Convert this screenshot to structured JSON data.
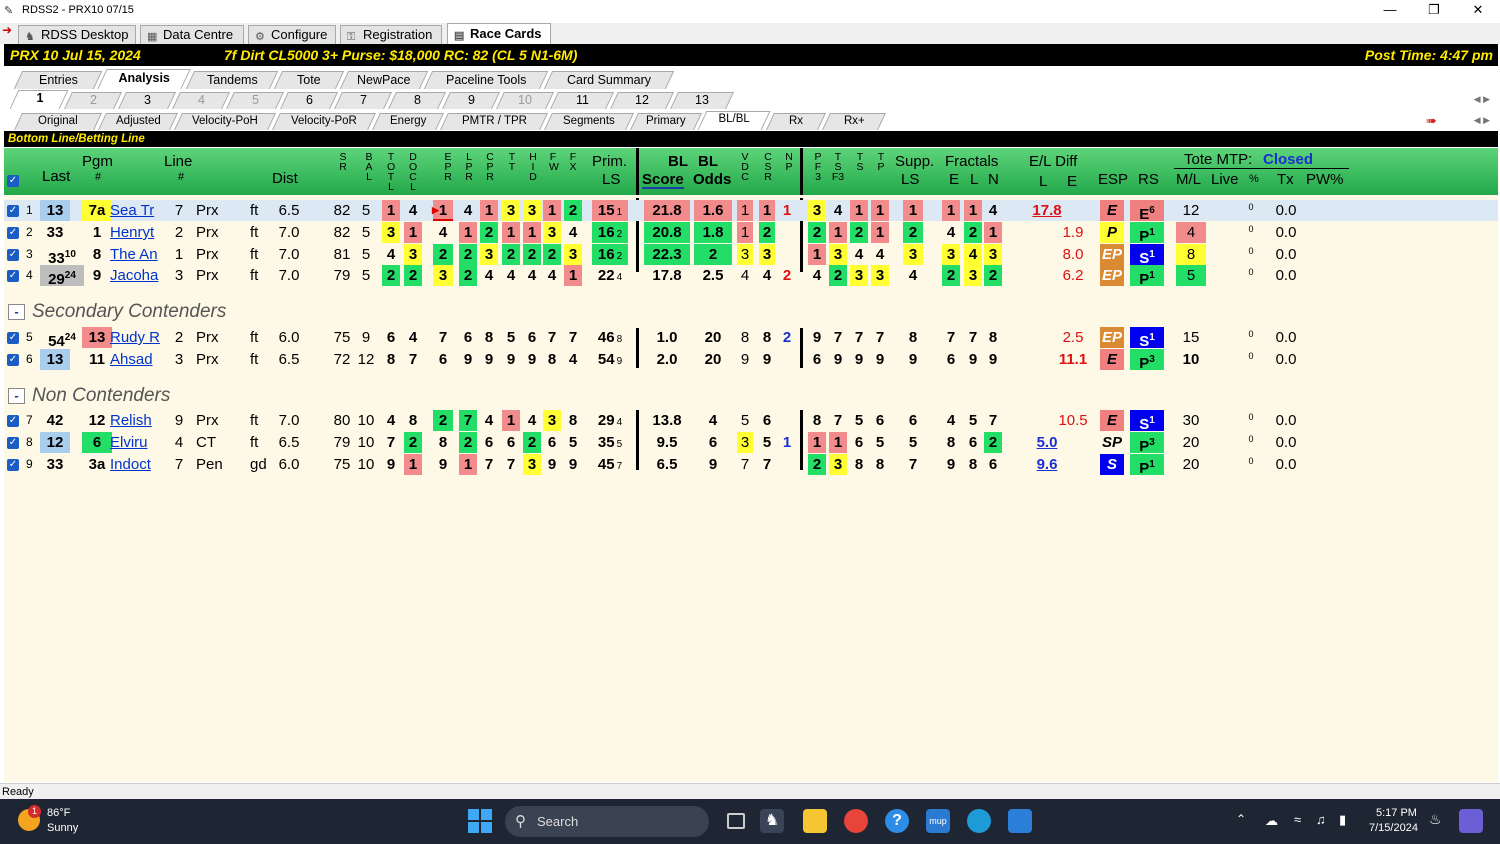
{
  "window": {
    "title": "RDSS2 - PRX10  07/15"
  },
  "main_tabs": [
    "RDSS Desktop",
    "Data Centre",
    "Configure",
    "Registration",
    "Race Cards"
  ],
  "race_header": {
    "left": "PRX  10   Jul 15, 2024",
    "center": "7f  Dirt   CL5000  3+   Purse: $18,000   RC: 82  (CL 5 N1-6M)",
    "right": "Post Time: 4:47 pm"
  },
  "sub_tabs": [
    "Entries",
    "Analysis",
    "Tandems",
    "Tote",
    "NewPace",
    "Paceline Tools",
    "Card Summary"
  ],
  "race_tabs": [
    "1",
    "2",
    "3",
    "4",
    "5",
    "6",
    "7",
    "8",
    "9",
    "10",
    "11",
    "12",
    "13"
  ],
  "view_tabs": [
    "Original",
    "Adjusted",
    "Velocity-PoH",
    "Velocity-PoR",
    "Energy",
    "PMTR / TPR",
    "Segments",
    "Primary",
    "BL/BL",
    "Rx",
    "Rx+"
  ],
  "section_title": "Bottom Line/Betting Line",
  "headers": {
    "last": "Last",
    "pgm": "Pgm",
    "pgm_hash": "#",
    "line": "Line",
    "line_hash": "#",
    "dist": "Dist",
    "sr": "S R",
    "bal": "B A L",
    "totl": "T O T L",
    "docl": "D O C L",
    "epr": "E P R",
    "lpr": "L P R",
    "cpr": "C P R",
    "tt": "T T",
    "hid": "H I D",
    "fw": "F W",
    "fx": "F X",
    "prim": "Prim.",
    "prim_ls": "LS",
    "bl": "BL",
    "score": "Score",
    "bl2": "BL",
    "odds": "Odds",
    "vdc": "V D C",
    "csr": "C S R",
    "np": "N P",
    "pf3": "P F 3",
    "tsf3": "T S F3",
    "ts": "T S",
    "tp": "T P",
    "supp": "Supp.",
    "supp_ls": "LS",
    "fractals": "Fractals",
    "frac_e": "E",
    "frac_l": "L",
    "frac_n": "N",
    "el_diff": "E/L Diff",
    "el_l": "L",
    "el_e": "E",
    "esp": "ESP",
    "rs": "RS",
    "tote": "Tote MTP:",
    "tote_status": "Closed",
    "ml": "M/L",
    "live": "Live",
    "pct": "%",
    "tx": "Tx",
    "pw": "PW%"
  },
  "groups": {
    "secondary": "Secondary Contenders",
    "non": "Non Contenders",
    "toggle": "-"
  },
  "rows": [
    {
      "n": "1",
      "last": "13",
      "pgm": "7a",
      "name": "Sea Tr",
      "line": "7",
      "trk": "Prx",
      "surf": "ft",
      "dist": "6.5",
      "sr": "82",
      "bal": "5",
      "totl": "1",
      "docl": "4",
      "epr": "1",
      "lpr": "4",
      "cpr": "1",
      "tt": "3",
      "hid": "3",
      "fw": "1",
      "fx": "2",
      "prim": "15",
      "prim_s": "1",
      "score": "21.8",
      "odds": "1.6",
      "vdc": "1",
      "csr": "1",
      "np": "1",
      "pf3": "3",
      "tsf3": "4",
      "ts": "1",
      "tp": "1",
      "supp": "1",
      "fe": "1",
      "fl": "1",
      "fn": "4",
      "ell": "17.8",
      "ele": "",
      "esp": "E",
      "rs": "E",
      "rs_s": "6",
      "ml": "12",
      "pct": "0",
      "tx": "0.0"
    },
    {
      "n": "2",
      "last": "33",
      "pgm": "1",
      "name": "Henryt",
      "line": "2",
      "trk": "Prx",
      "surf": "ft",
      "dist": "7.0",
      "sr": "82",
      "bal": "5",
      "totl": "3",
      "docl": "1",
      "epr": "4",
      "lpr": "1",
      "cpr": "2",
      "tt": "1",
      "hid": "1",
      "fw": "3",
      "fx": "4",
      "prim": "16",
      "prim_s": "2",
      "score": "20.8",
      "odds": "1.8",
      "vdc": "1",
      "csr": "2",
      "np": "",
      "pf3": "2",
      "tsf3": "1",
      "ts": "2",
      "tp": "1",
      "supp": "2",
      "fe": "4",
      "fl": "2",
      "fn": "1",
      "ell": "",
      "ele": "1.9",
      "esp": "P",
      "rs": "P",
      "rs_s": "1",
      "ml": "4",
      "pct": "0",
      "tx": "0.0"
    },
    {
      "n": "3",
      "last": "33",
      "last_s": "10",
      "pgm": "8",
      "name": "The An",
      "line": "1",
      "trk": "Prx",
      "surf": "ft",
      "dist": "7.0",
      "sr": "81",
      "bal": "5",
      "totl": "4",
      "docl": "3",
      "epr": "2",
      "lpr": "2",
      "cpr": "3",
      "tt": "2",
      "hid": "2",
      "fw": "2",
      "fx": "3",
      "prim": "16",
      "prim_s": "2",
      "score": "22.3",
      "odds": "2",
      "vdc": "3",
      "csr": "3",
      "np": "",
      "pf3": "1",
      "tsf3": "3",
      "ts": "4",
      "tp": "4",
      "supp": "3",
      "fe": "3",
      "fl": "4",
      "fn": "3",
      "ell": "",
      "ele": "8.0",
      "esp": "EP",
      "rs": "S",
      "rs_s": "1",
      "ml": "8",
      "pct": "0",
      "tx": "0.0"
    },
    {
      "n": "4",
      "last": "29",
      "last_s": "24",
      "pgm": "9",
      "name": "Jacoha",
      "line": "3",
      "trk": "Prx",
      "surf": "ft",
      "dist": "7.0",
      "sr": "79",
      "bal": "5",
      "totl": "2",
      "docl": "2",
      "epr": "3",
      "lpr": "2",
      "cpr": "4",
      "tt": "4",
      "hid": "4",
      "fw": "4",
      "fx": "1",
      "prim": "22",
      "prim_s": "4",
      "score": "17.8",
      "odds": "2.5",
      "vdc": "4",
      "csr": "4",
      "np": "2",
      "pf3": "4",
      "tsf3": "2",
      "ts": "3",
      "tp": "3",
      "supp": "4",
      "fe": "2",
      "fl": "3",
      "fn": "2",
      "ell": "",
      "ele": "6.2",
      "esp": "EP",
      "rs": "P",
      "rs_s": "1",
      "ml": "5",
      "pct": "0",
      "tx": "0.0"
    },
    {
      "n": "5",
      "last": "54",
      "last_s": "24",
      "pgm": "13",
      "name": "Rudy R",
      "line": "2",
      "trk": "Prx",
      "surf": "ft",
      "dist": "6.0",
      "sr": "75",
      "bal": "9",
      "totl": "6",
      "docl": "4",
      "epr": "7",
      "lpr": "6",
      "cpr": "8",
      "tt": "5",
      "hid": "6",
      "fw": "7",
      "fx": "7",
      "prim": "46",
      "prim_s": "8",
      "score": "1.0",
      "odds": "20",
      "vdc": "8",
      "csr": "8",
      "np": "2",
      "pf3": "9",
      "tsf3": "7",
      "ts": "7",
      "tp": "7",
      "supp": "8",
      "fe": "7",
      "fl": "7",
      "fn": "8",
      "ell": "",
      "ele": "2.5",
      "esp": "EP",
      "rs": "S",
      "rs_s": "1",
      "ml": "15",
      "pct": "0",
      "tx": "0.0"
    },
    {
      "n": "6",
      "last": "13",
      "pgm": "11",
      "name": "Ahsad",
      "line": "3",
      "trk": "Prx",
      "surf": "ft",
      "dist": "6.5",
      "sr": "72",
      "bal": "12",
      "totl": "8",
      "docl": "7",
      "epr": "6",
      "lpr": "9",
      "cpr": "9",
      "tt": "9",
      "hid": "9",
      "fw": "8",
      "fx": "4",
      "prim": "54",
      "prim_s": "9",
      "score": "2.0",
      "odds": "20",
      "vdc": "9",
      "csr": "9",
      "np": "",
      "pf3": "6",
      "tsf3": "9",
      "ts": "9",
      "tp": "9",
      "supp": "9",
      "fe": "6",
      "fl": "9",
      "fn": "9",
      "ell": "",
      "ele": "11.1",
      "esp": "E",
      "rs": "P",
      "rs_s": "3",
      "ml": "10",
      "pct": "0",
      "tx": "0.0"
    },
    {
      "n": "7",
      "last": "42",
      "pgm": "12",
      "name": "Relish",
      "line": "9",
      "trk": "Prx",
      "surf": "ft",
      "dist": "7.0",
      "sr": "80",
      "bal": "10",
      "totl": "4",
      "docl": "8",
      "epr": "2",
      "lpr": "7",
      "cpr": "4",
      "tt": "1",
      "hid": "4",
      "fw": "3",
      "fx": "8",
      "prim": "29",
      "prim_s": "4",
      "score": "13.8",
      "odds": "4",
      "vdc": "5",
      "csr": "6",
      "np": "",
      "pf3": "8",
      "tsf3": "7",
      "ts": "5",
      "tp": "6",
      "supp": "6",
      "fe": "4",
      "fl": "5",
      "fn": "7",
      "ell": "",
      "ele": "10.5",
      "esp": "E",
      "rs": "S",
      "rs_s": "1",
      "ml": "30",
      "pct": "0",
      "tx": "0.0"
    },
    {
      "n": "8",
      "last": "12",
      "pgm": "6",
      "name": "Elviru",
      "line": "4",
      "trk": "CT",
      "surf": "ft",
      "dist": "6.5",
      "sr": "79",
      "bal": "10",
      "totl": "7",
      "docl": "2",
      "epr": "8",
      "lpr": "2",
      "cpr": "6",
      "tt": "6",
      "hid": "2",
      "fw": "6",
      "fx": "5",
      "prim": "35",
      "prim_s": "5",
      "score": "9.5",
      "odds": "6",
      "vdc": "3",
      "csr": "5",
      "np": "1",
      "pf3": "1",
      "tsf3": "1",
      "ts": "6",
      "tp": "5",
      "supp": "5",
      "fe": "8",
      "fl": "6",
      "fn": "2",
      "ell": "5.0",
      "ele": "",
      "esp": "SP",
      "rs": "P",
      "rs_s": "3",
      "ml": "20",
      "pct": "0",
      "tx": "0.0"
    },
    {
      "n": "9",
      "last": "33",
      "pgm": "3a",
      "name": "Indoct",
      "line": "7",
      "trk": "Pen",
      "surf": "gd",
      "dist": "6.0",
      "sr": "75",
      "bal": "10",
      "totl": "9",
      "docl": "1",
      "epr": "9",
      "lpr": "1",
      "cpr": "7",
      "tt": "7",
      "hid": "3",
      "fw": "9",
      "fx": "9",
      "prim": "45",
      "prim_s": "7",
      "score": "6.5",
      "odds": "9",
      "vdc": "7",
      "csr": "7",
      "np": "",
      "pf3": "2",
      "tsf3": "3",
      "ts": "8",
      "tp": "8",
      "supp": "7",
      "fe": "9",
      "fl": "8",
      "fn": "6",
      "ell": "9.6",
      "ele": "",
      "esp": "S",
      "rs": "P",
      "rs_s": "1",
      "ml": "20",
      "pct": "0",
      "tx": "0.0"
    }
  ],
  "status": "Ready",
  "taskbar": {
    "temp": "86°F",
    "weather": "Sunny",
    "badge": "1",
    "search": "Search",
    "time": "5:17 PM",
    "date": "7/15/2024"
  }
}
